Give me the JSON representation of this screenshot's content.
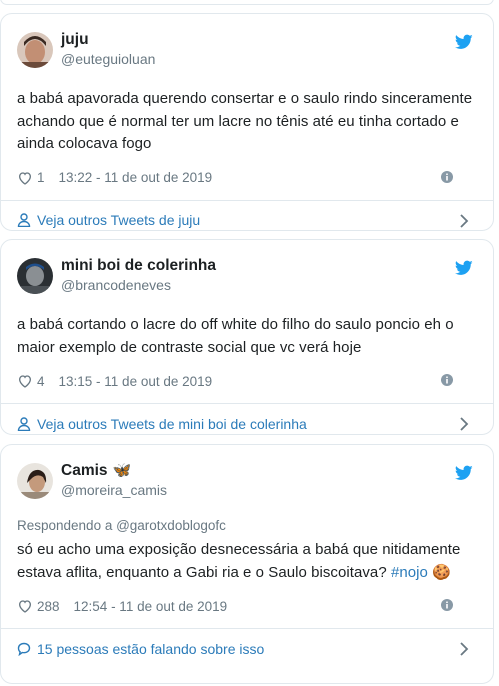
{
  "tweets": [
    {
      "name": "juju",
      "handle": "@euteguioluan",
      "text": "a babá apavorada querendo consertar e o saulo rindo sinceramente achando que é normal ter um lacre no tênis até eu tinha cortado e ainda colocava fogo",
      "likes": "1",
      "timestamp": "13:22 - 11 de out de 2019",
      "footer_label": "Veja outros Tweets de juju"
    },
    {
      "name": "mini boi de colerinha",
      "handle": "@brancodeneves",
      "text": "a babá cortando o lacre do off white do filho do saulo poncio eh o maior exemplo de contraste social que vc verá hoje",
      "likes": "4",
      "timestamp": "13:15 - 11 de out de 2019",
      "footer_label": "Veja outros Tweets de mini boi de colerinha"
    },
    {
      "name": "Camis",
      "name_emoji": "🦋",
      "handle": "@moreira_camis",
      "reply_to": "Respondendo a @garotxdoblogofc",
      "text": "só eu acho uma exposição desnecessária a babá que nitidamente estava aflita, enquanto a Gabi ria e o Saulo biscoitava?",
      "hashtag": "#nojo",
      "text_emoji": "🍪",
      "likes": "288",
      "timestamp": "12:54 - 11 de out de 2019",
      "footer_label": "15 pessoas estão falando sobre isso"
    }
  ],
  "colors": {
    "link": "#2b7bb9",
    "twitter_blue": "#1da1f2",
    "muted": "#697882",
    "border": "#e1e8ed"
  }
}
